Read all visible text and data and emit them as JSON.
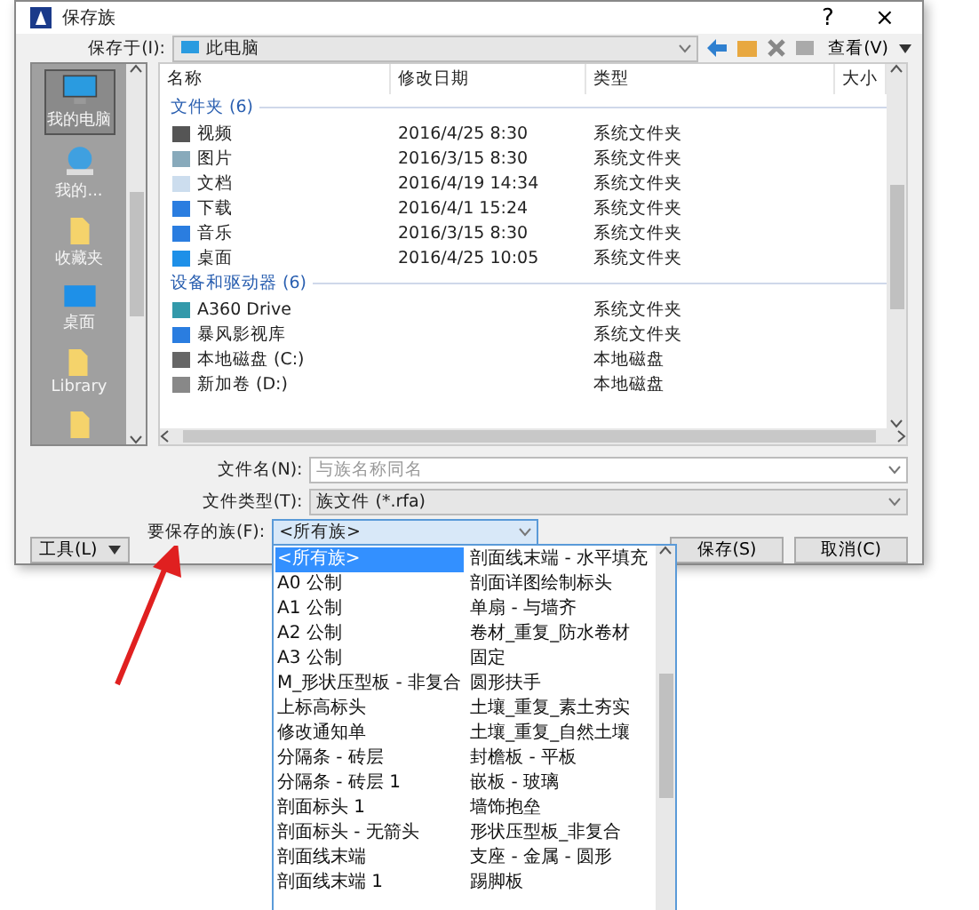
{
  "window": {
    "title": "保存族",
    "help": "?",
    "close": "×"
  },
  "save_in": {
    "label": "保存于(I):",
    "value": "此电脑"
  },
  "toolbar": {
    "view": "查看(V)"
  },
  "places": [
    {
      "label": "我的电脑",
      "selected": true
    },
    {
      "label": "我的...",
      "selected": false
    },
    {
      "label": "收藏夹",
      "selected": false
    },
    {
      "label": "桌面",
      "selected": false
    },
    {
      "label": "Library",
      "selected": false
    },
    {
      "selected": false
    }
  ],
  "file_list": {
    "columns": [
      "名称",
      "修改日期",
      "类型",
      "大小"
    ],
    "groups": [
      {
        "title": "文件夹 (6)",
        "rows": [
          {
            "name": "视频",
            "date": "2016/4/25 8:30",
            "type": "系统文件夹"
          },
          {
            "name": "图片",
            "date": "2016/3/15 8:30",
            "type": "系统文件夹"
          },
          {
            "name": "文档",
            "date": "2016/4/19 14:34",
            "type": "系统文件夹"
          },
          {
            "name": "下载",
            "date": "2016/4/1 15:24",
            "type": "系统文件夹"
          },
          {
            "name": "音乐",
            "date": "2016/3/15 8:30",
            "type": "系统文件夹"
          },
          {
            "name": "桌面",
            "date": "2016/4/25 10:05",
            "type": "系统文件夹"
          }
        ]
      },
      {
        "title": "设备和驱动器 (6)",
        "rows": [
          {
            "name": "A360 Drive",
            "type": "系统文件夹"
          },
          {
            "name": "暴风影视库",
            "type": "系统文件夹"
          },
          {
            "name": "本地磁盘 (C:)",
            "type": "本地磁盘"
          },
          {
            "name": "新加卷 (D:)",
            "type": "本地磁盘"
          }
        ]
      }
    ]
  },
  "file_name": {
    "label": "文件名(N):",
    "placeholder": "与族名称同名"
  },
  "file_type": {
    "label": "文件类型(T):",
    "value": "族文件 (*.rfa)"
  },
  "family_to_save": {
    "label": "要保存的族(F):",
    "value": "<所有族>",
    "options": [
      {
        "label": "<所有族>",
        "selected": true
      },
      {
        "label": "A0 公制",
        "selected": false
      },
      {
        "label": "A1 公制",
        "selected": false
      },
      {
        "label": "A2 公制",
        "selected": false
      },
      {
        "label": "A3 公制",
        "selected": false
      },
      {
        "label": "M_形状压型板 - 非复合",
        "selected": false
      },
      {
        "label": "上标高标头",
        "selected": false
      },
      {
        "label": "修改通知单",
        "selected": false
      },
      {
        "label": "分隔条 - 砖层",
        "selected": false
      },
      {
        "label": "分隔条 - 砖层 1",
        "selected": false
      },
      {
        "label": "剖面标头 1",
        "selected": false
      },
      {
        "label": "剖面标头 - 无箭头",
        "selected": false
      },
      {
        "label": "剖面线末端",
        "selected": false
      },
      {
        "label": "剖面线末端 1",
        "selected": false
      },
      {
        "label": "剖面线末端 - 水平填充",
        "selected": false
      },
      {
        "label": "剖面详图绘制标头",
        "selected": false
      },
      {
        "label": "单扇 - 与墙齐",
        "selected": false
      },
      {
        "label": "卷材_重复_防水卷材",
        "selected": false
      },
      {
        "label": "固定",
        "selected": false
      },
      {
        "label": "圆形扶手",
        "selected": false
      },
      {
        "label": "土壤_重复_素土夯实",
        "selected": false
      },
      {
        "label": "土壤_重复_自然土壤",
        "selected": false
      },
      {
        "label": "封檐板 - 平板",
        "selected": false
      },
      {
        "label": "嵌板 - 玻璃",
        "selected": false
      },
      {
        "label": "墙饰抱垒",
        "selected": false
      },
      {
        "label": "形状压型板_非复合",
        "selected": false
      },
      {
        "label": "支座 - 金属 - 圆形",
        "selected": false
      },
      {
        "label": "踢脚板",
        "selected": false
      }
    ]
  },
  "buttons": {
    "tools": "工具(L)",
    "save": "保存(S)",
    "cancel": "取消(C)"
  }
}
